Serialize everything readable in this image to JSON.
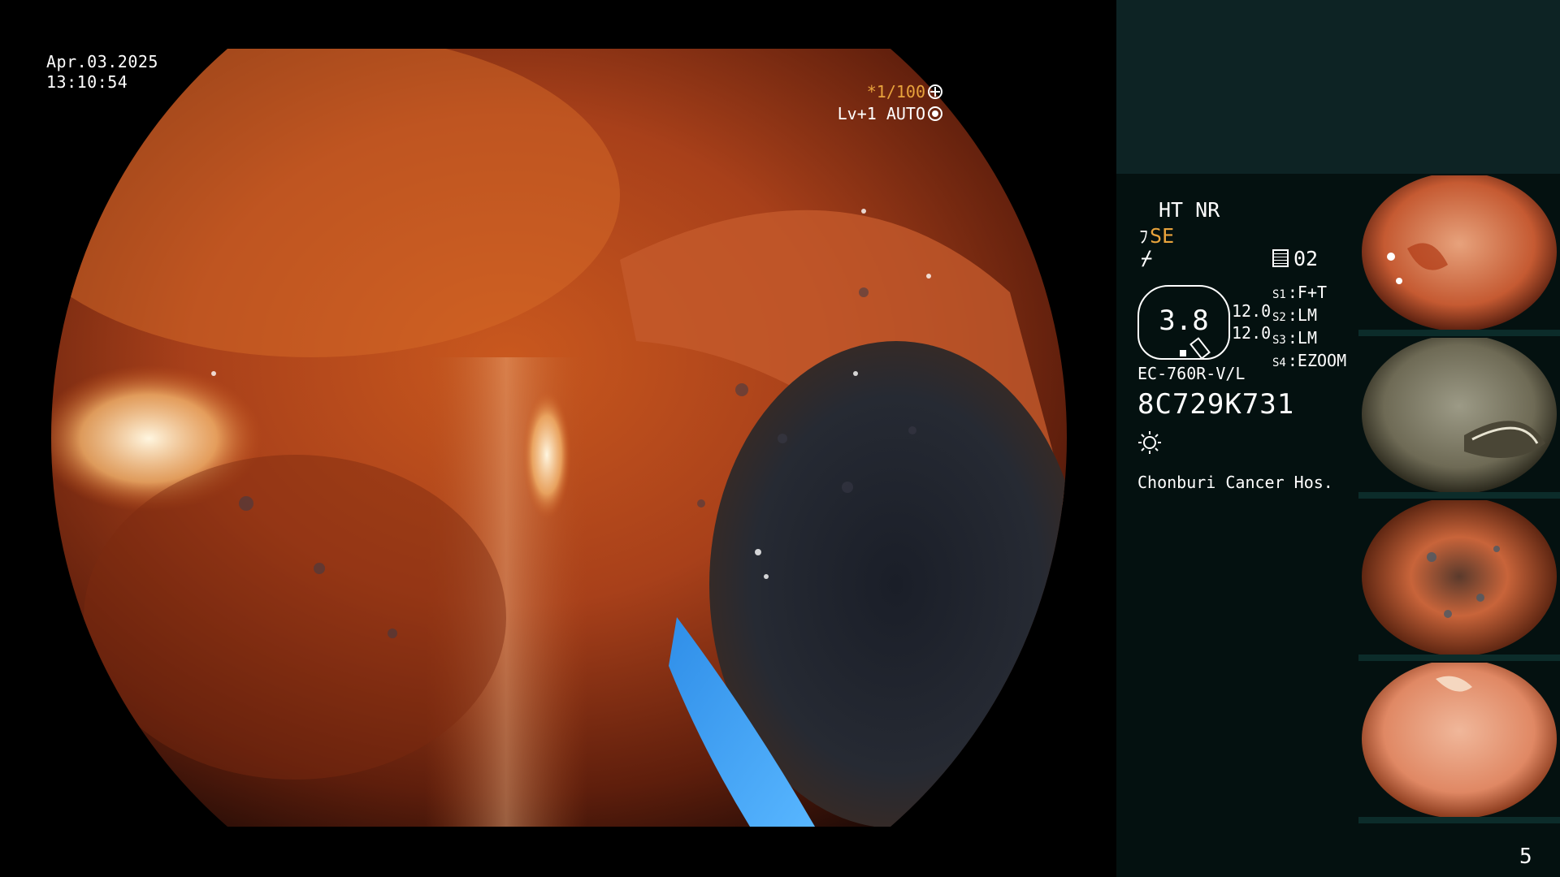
{
  "overlay": {
    "date": "Apr.03.2025",
    "time": "13:10:54",
    "shutter": "*1/100",
    "level": "Lv+1 AUTO"
  },
  "panel": {
    "mode_line1": "HT NR",
    "mode_line2_prefix": "ﾌ",
    "mode_line2": "SE",
    "mode_line3": "⌿",
    "memory": "02",
    "zoom_value": "3.8",
    "levels": [
      "12.0",
      "12.0"
    ],
    "slots": [
      {
        "key": "S1",
        "value": "F+T"
      },
      {
        "key": "S2",
        "value": "LM"
      },
      {
        "key": "S3",
        "value": "LM"
      },
      {
        "key": "S4",
        "value": "EZOOM"
      }
    ],
    "scope_model": "EC-760R-V/L",
    "serial": "8C729K731",
    "hospital": "Chonburi Cancer Hos.",
    "page_number": "5"
  },
  "colors": {
    "accent_orange": "#e8a33c",
    "panel_top": "#0d2324",
    "panel_bottom": "#041110"
  },
  "icons": [
    "shutter-icon",
    "auto-light-icon",
    "memory-icon",
    "brightness-icon"
  ]
}
